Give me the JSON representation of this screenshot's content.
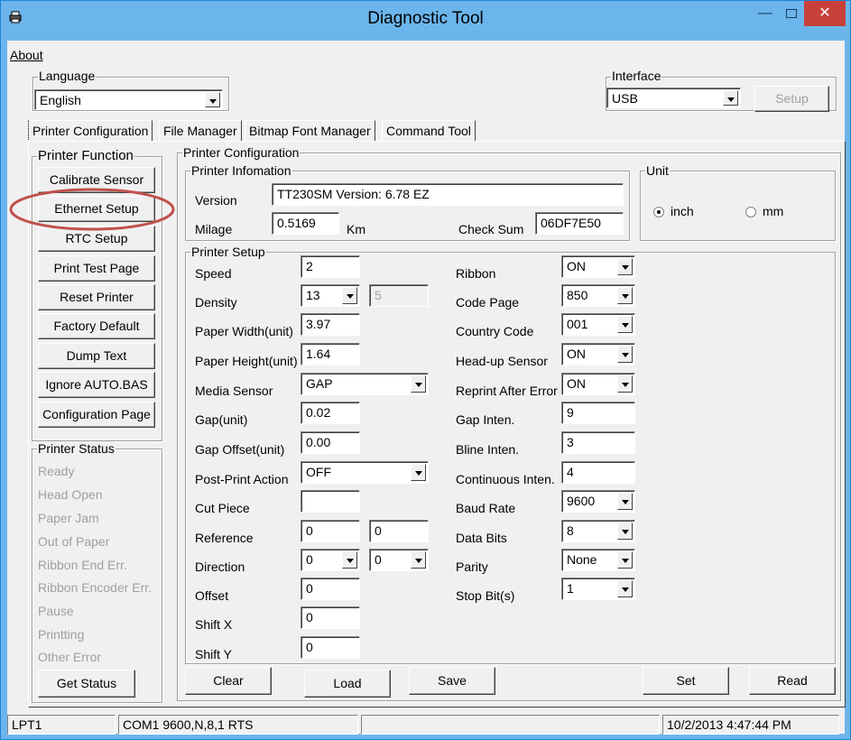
{
  "window": {
    "title": "Diagnostic Tool"
  },
  "menu": {
    "about": "About"
  },
  "language": {
    "label": "Language",
    "value": "English"
  },
  "interface": {
    "label": "Interface",
    "value": "USB",
    "setup": "Setup"
  },
  "tabs": [
    "Printer Configuration",
    "File Manager",
    "Bitmap Font Manager",
    "Command Tool"
  ],
  "printer_function": {
    "title": "Printer Function",
    "buttons": [
      "Calibrate Sensor",
      "Ethernet Setup",
      "RTC Setup",
      "Print Test Page",
      "Reset Printer",
      "Factory Default",
      "Dump Text",
      "Ignore AUTO.BAS",
      "Configuration Page"
    ]
  },
  "printer_status": {
    "title": "Printer Status",
    "items": [
      "Ready",
      "Head Open",
      "Paper Jam",
      "Out of Paper",
      "Ribbon End Err.",
      "Ribbon Encoder Err.",
      "Pause",
      "Printting",
      "Other Error"
    ],
    "get_status": "Get Status"
  },
  "config": {
    "title": "Printer Configuration",
    "info_title": "Printer Infomation",
    "version_label": "Version",
    "version_value": "TT230SM Version: 6.78 EZ",
    "milage_label": "Milage",
    "milage_value": "0.5169",
    "milage_unit": "Km",
    "checksum_label": "Check Sum",
    "checksum_value": "06DF7E50",
    "unit_title": "Unit",
    "unit_inch": "inch",
    "unit_mm": "mm",
    "unit_selected": "inch",
    "setup_title": "Printer Setup",
    "left": {
      "speed_label": "Speed",
      "speed": "2",
      "density_label": "Density",
      "density": "13",
      "density_extra": "5",
      "paper_width_label": "Paper Width(unit)",
      "paper_width": "3.97",
      "paper_height_label": "Paper Height(unit)",
      "paper_height": "1.64",
      "media_sensor_label": "Media Sensor",
      "media_sensor": "GAP",
      "gap_label": "Gap(unit)",
      "gap": "0.02",
      "gap_offset_label": "Gap Offset(unit)",
      "gap_offset": "0.00",
      "post_print_label": "Post-Print Action",
      "post_print": "OFF",
      "cut_piece_label": "Cut Piece",
      "cut_piece": "",
      "reference_label": "Reference",
      "reference_x": "0",
      "reference_y": "0",
      "direction_label": "Direction",
      "direction_a": "0",
      "direction_b": "0",
      "offset_label": "Offset",
      "offset": "0",
      "shift_x_label": "Shift X",
      "shift_x": "0",
      "shift_y_label": "Shift Y",
      "shift_y": "0"
    },
    "right": {
      "ribbon_label": "Ribbon",
      "ribbon": "ON",
      "code_page_label": "Code Page",
      "code_page": "850",
      "country_code_label": "Country Code",
      "country_code": "001",
      "head_up_label": "Head-up Sensor",
      "head_up": "ON",
      "reprint_label": "Reprint After Error",
      "reprint": "ON",
      "gap_inten_label": "Gap Inten.",
      "gap_inten": "9",
      "bline_inten_label": "Bline Inten.",
      "bline_inten": "3",
      "cont_inten_label": "Continuous Inten.",
      "cont_inten": "4",
      "baud_label": "Baud Rate",
      "baud": "9600",
      "data_bits_label": "Data Bits",
      "data_bits": "8",
      "parity_label": "Parity",
      "parity": "None",
      "stop_bits_label": "Stop Bit(s)",
      "stop_bits": "1"
    },
    "actions": {
      "clear": "Clear",
      "load": "Load",
      "save": "Save",
      "set": "Set",
      "read": "Read"
    }
  },
  "statusbar": {
    "port": "LPT1",
    "com": "COM1 9600,N,8,1 RTS",
    "middle": "",
    "datetime": "10/2/2013 4:47:44 PM"
  },
  "colors": {
    "title_bar": "#6bb5ec",
    "close_button": "#c7413a",
    "highlight_circle": "#c0504d"
  }
}
